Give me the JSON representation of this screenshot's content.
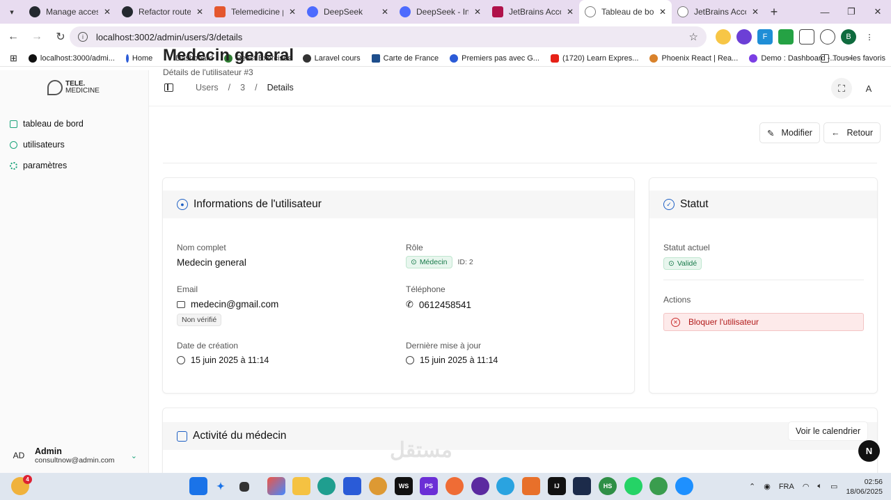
{
  "browser": {
    "tabs": [
      {
        "title": "Manage access",
        "color": "#24292f"
      },
      {
        "title": "Refactor route de",
        "color": "#24292f"
      },
      {
        "title": "Telemedicine pla",
        "color": "#e4572e"
      },
      {
        "title": "DeepSeek",
        "color": "#4d6bfe"
      },
      {
        "title": "DeepSeek - Into",
        "color": "#4d6bfe"
      },
      {
        "title": "JetBrains Accoun",
        "color": "#b0124a"
      },
      {
        "title": "Tableau de bord",
        "color": "#7a7a7a"
      },
      {
        "title": "JetBrains Accoun",
        "color": "#7a7a7a"
      }
    ],
    "url": "localhost:3002/admin/users/3/details",
    "bookmarks": [
      {
        "label": "localhost:3000/admi...",
        "color": "#111"
      },
      {
        "label": "Home",
        "color": "#2b5bd7"
      },
      {
        "label": "Dashboard",
        "color": "#ffffff"
      },
      {
        "label": "React Exercises",
        "color": "#2e7d32"
      },
      {
        "label": "Laravel cours",
        "color": "#333"
      },
      {
        "label": "Carte de France",
        "color": "#1e4e8c"
      },
      {
        "label": "Premiers pas avec G...",
        "color": "#2b5bd7"
      },
      {
        "label": "(1720) Learn Expres...",
        "color": "#e62117"
      },
      {
        "label": "Phoenix React | Rea...",
        "color": "#d9822b"
      },
      {
        "label": "Demo : Dashboard -...",
        "color": "#7b3fe4"
      }
    ],
    "all_bookmarks": "Tous les favoris"
  },
  "sidebar": {
    "logo_line1": "TELE.",
    "logo_line2": "MEDICINE",
    "items": [
      {
        "label": "tableau de bord"
      },
      {
        "label": "utilisateurs"
      },
      {
        "label": "paramètres"
      }
    ],
    "user": {
      "initials": "AD",
      "name": "Admin",
      "email": "consultnow@admin.com"
    }
  },
  "topbar": {
    "breadcrumbs": [
      "Users",
      "3",
      "Details"
    ],
    "account_initial": "A"
  },
  "page": {
    "title": "Medecin general",
    "subtitle": "Détails de l'utilisateur #3",
    "edit_label": "Modifier",
    "back_label": "Retour"
  },
  "user_info": {
    "heading": "Informations de l'utilisateur",
    "full_name_label": "Nom complet",
    "full_name": "Medecin general",
    "role_label": "Rôle",
    "role": "Médecin",
    "role_id": "ID: 2",
    "email_label": "Email",
    "email": "medecin@gmail.com",
    "email_status": "Non vérifié",
    "phone_label": "Téléphone",
    "phone": "0612458541",
    "created_label": "Date de création",
    "created": "15 juin 2025 à 11:14",
    "updated_label": "Dernière mise à jour",
    "updated": "15 juin 2025 à 11:14"
  },
  "status": {
    "heading": "Statut",
    "current_label": "Statut actuel",
    "current": "Validé",
    "actions_label": "Actions",
    "block_label": "Bloquer l'utilisateur"
  },
  "activity": {
    "heading": "Activité du médecin",
    "calendar_label": "Voir le calendrier"
  },
  "watermark": "مستقل",
  "taskbar": {
    "language": "FRA",
    "time": "02:56",
    "date": "18/06/2025",
    "weather_badge": "4"
  }
}
